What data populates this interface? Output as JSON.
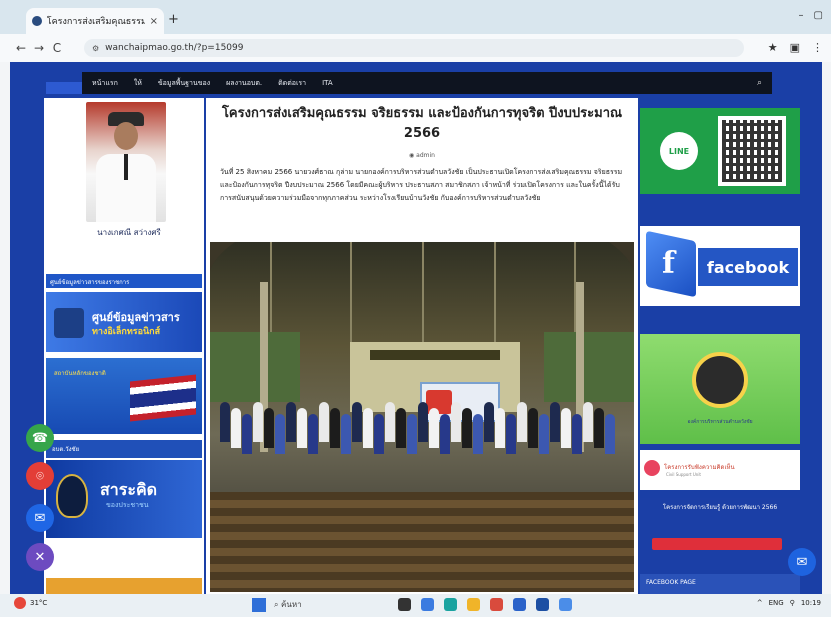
{
  "browser": {
    "tab_title": "โครงการส่งเสริมคุณธรรม จริ...",
    "tab_close": "×",
    "new_tab": "+",
    "url": "wanchaipmao.go.th/?p=15099",
    "back": "←",
    "forward": "→",
    "reload": "C",
    "star": "★",
    "menu": "⋮"
  },
  "site": {
    "nav": [
      "หน้าแรก",
      "ให้",
      "ข้อมูลพื้นฐานของ",
      "ผลงานอบต.",
      "ติดต่อเรา",
      "ITA"
    ],
    "search_icon": "search-icon",
    "official_name": "นางเกศณี สว่างศรี",
    "left_banner_small": "ศูนย์ข้อมูลข่าวสารของราชการ",
    "info_center_line1": "ศูนย์ข้อมูลข่าวสาร",
    "info_center_line2": "ทางอิเล็กทรอนิกส์",
    "flag_banner_text": "สถาบันหลักของชาติ",
    "left_banner_4": "อบต.วังชัย",
    "sarakit_title": "สาระคิด",
    "sarakit_sub": "ของประชาชน"
  },
  "article": {
    "title": "โครงการส่งเสริมคุณธรรม จริยธรรม และป้องกันการทุจริต ปีงบประมาณ 2566",
    "author": "admin",
    "body": "วันที่ 25 สิงหาคม 2566 นายวงศ์ธาณ กุล่าม นายกองค์การบริหารส่วนตำบลวังชัย เป็นประธานเปิดโครงการส่งเสริมคุณธรรม จริยธรรม และป้องกันการทุจริต ปีงบประมาณ 2566 โดยมีคณะผู้บริหาร ประธานสภา สมาชิกสภา เจ้าหน้าที่ ร่วมเปิดโครงการ และในครั้งนี้ได้รับการสนับสนุนด้วยความร่วมมือจากทุกภาคส่วน ระหว่างโรงเรียนบ้านวังชัย กับองค์การบริหารส่วนตำบลวังชัย"
  },
  "right": {
    "line_label": "LINE",
    "facebook_label": "facebook",
    "emblem_caption": "องค์การบริหารส่วนตำบลวังชัย",
    "small_link": "โครงการรับฟังความคิดเห็น",
    "small_link_sub": "Civil Support Unit",
    "blue_box_text": "โครงการจัดการเรียนรู้ ด้วยการพัฒนา 2566",
    "fb_page_label": "FACEBOOK PAGE"
  },
  "floating": {
    "phone": "☎",
    "map": "⌾",
    "messenger": "✉",
    "close": "✕",
    "chat": "✉"
  },
  "taskbar": {
    "weather": "31°C",
    "search": "ค้นหา",
    "tray": [
      "^",
      "ENG",
      "⚲",
      "10:19"
    ]
  },
  "colors": {
    "page_bg": "#1a3fa6",
    "nav_bg": "#0e1420",
    "line_green": "#1f9f48",
    "facebook_blue": "#2456c4"
  }
}
